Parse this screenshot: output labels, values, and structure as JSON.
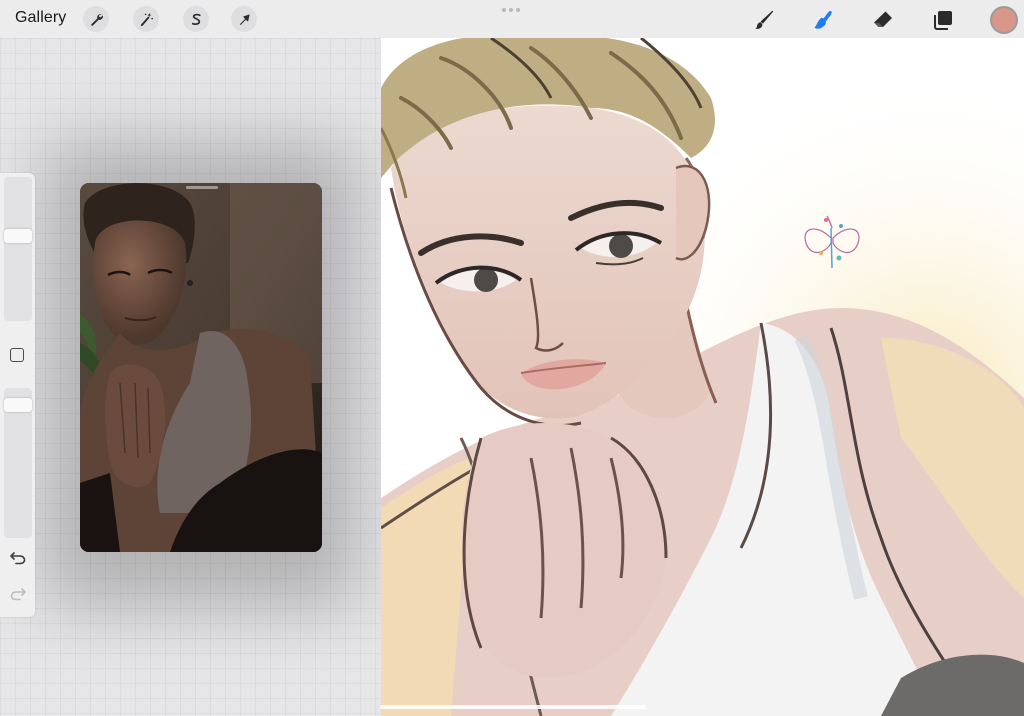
{
  "topbar": {
    "gallery_label": "Gallery",
    "left_tools": [
      {
        "icon": "wrench-icon",
        "name": "actions"
      },
      {
        "icon": "magic-wand-icon",
        "name": "adjustments"
      },
      {
        "icon": "selection-s-icon",
        "name": "selection"
      },
      {
        "icon": "arrow-cursor-icon",
        "name": "transform"
      }
    ],
    "right_tools": [
      {
        "icon": "brush-icon",
        "name": "paint"
      },
      {
        "icon": "smudge-finger-icon",
        "name": "smudge",
        "active": true
      },
      {
        "icon": "eraser-icon",
        "name": "erase"
      },
      {
        "icon": "layers-icon",
        "name": "layers"
      }
    ],
    "active_color": "#d9968a",
    "accent_color": "#1f7cf2"
  },
  "sidebar": {
    "size_slider_level": 0.6,
    "opacity_slider_level": 0.93,
    "modify_button_icon": "square-icon",
    "undo_icon": "undo-arrow-icon",
    "redo_icon": "redo-arrow-icon"
  },
  "reference": {
    "description_icon": "reference-photo"
  },
  "canvas": {
    "background": "#ffffff",
    "signature_icon": "butterfly-signature-icon"
  }
}
